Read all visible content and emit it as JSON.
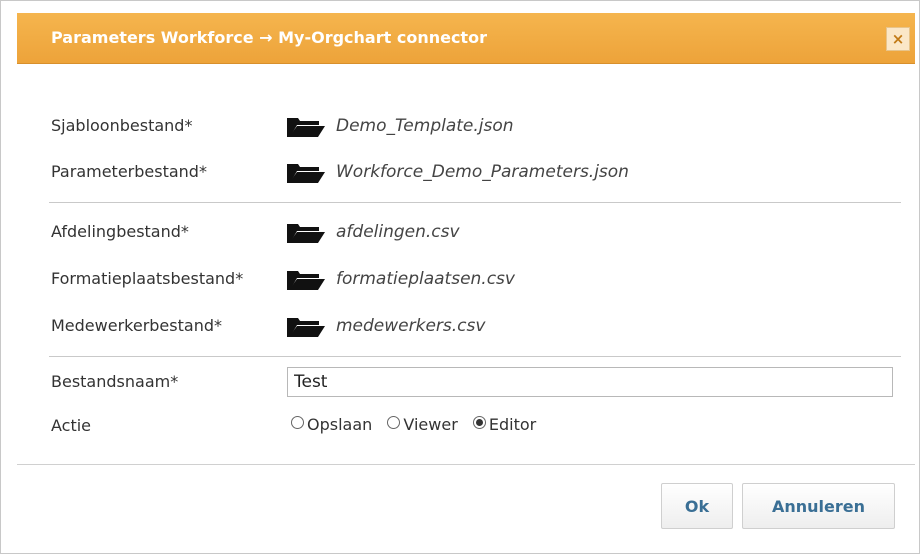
{
  "dialog": {
    "title": "Parameters Workforce → My-Orgchart connector",
    "close_label": "×"
  },
  "files": [
    {
      "label": "Sjabloonbestand*",
      "filename": "Demo_Template.json",
      "icon": "folder-icon"
    },
    {
      "label": "Parameterbestand*",
      "filename": "Workforce_Demo_Parameters.json",
      "icon": "folder-icon"
    },
    {
      "label": "Afdelingbestand*",
      "filename": "afdelingen.csv",
      "icon": "folder-icon"
    },
    {
      "label": "Formatieplaatsbestand*",
      "filename": "formatieplaatsen.csv",
      "icon": "folder-icon"
    },
    {
      "label": "Medewerkerbestand*",
      "filename": "medewerkers.csv",
      "icon": "folder-icon"
    }
  ],
  "bestandsnaam": {
    "label": "Bestandsnaam*",
    "value": "Test"
  },
  "actie": {
    "label": "Actie",
    "options": [
      "Opslaan",
      "Viewer",
      "Editor"
    ],
    "selected": "Editor"
  },
  "buttons": {
    "ok": "Ok",
    "cancel": "Annuleren"
  }
}
